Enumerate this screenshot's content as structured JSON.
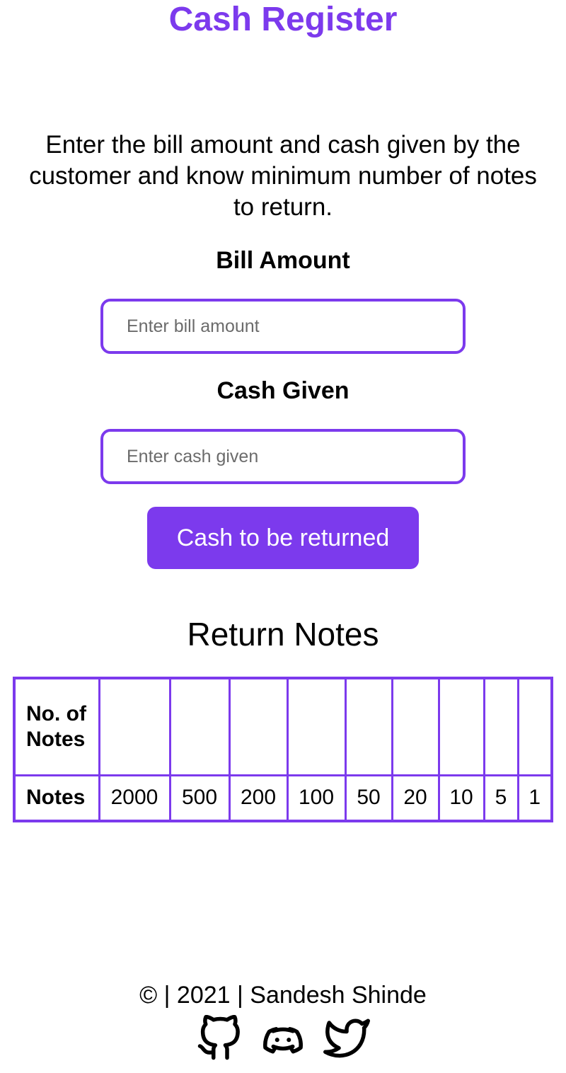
{
  "header": {
    "title": "Cash Register"
  },
  "intro": {
    "description": "Enter the bill amount and cash given by the customer and know minimum number of notes to return."
  },
  "form": {
    "bill_label": "Bill Amount",
    "bill_placeholder": "Enter bill amount",
    "bill_value": "",
    "cash_label": "Cash Given",
    "cash_placeholder": "Enter cash given",
    "cash_value": "",
    "submit_label": "Cash to be returned"
  },
  "return_notes": {
    "heading": "Return Notes",
    "count_header": "No. of Notes",
    "notes_header": "Notes",
    "denominations": [
      "2000",
      "500",
      "200",
      "100",
      "50",
      "20",
      "10",
      "5",
      "1"
    ],
    "counts": [
      "",
      "",
      "",
      "",
      "",
      "",
      "",
      "",
      ""
    ]
  },
  "footer": {
    "text": "© | 2021 | Sandesh Shinde",
    "links": [
      {
        "icon": "github-icon"
      },
      {
        "icon": "discord-icon"
      },
      {
        "icon": "twitter-icon"
      }
    ]
  },
  "colors": {
    "accent": "#7c3aed",
    "text": "#000000",
    "background": "#ffffff"
  }
}
